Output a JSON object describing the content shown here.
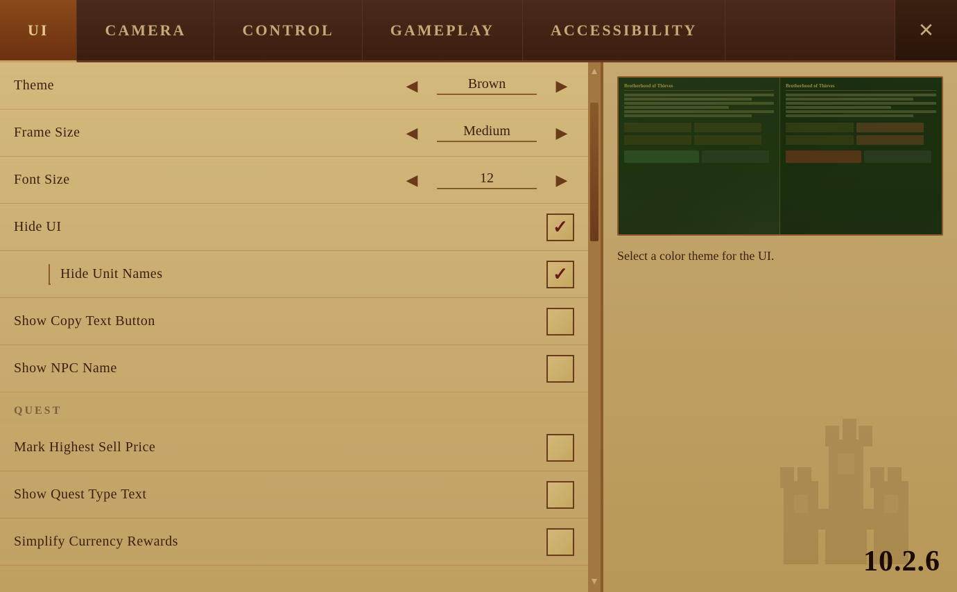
{
  "tabs": [
    {
      "id": "ui",
      "label": "UI",
      "active": true
    },
    {
      "id": "camera",
      "label": "CAMERA",
      "active": false
    },
    {
      "id": "control",
      "label": "CONTROL",
      "active": false
    },
    {
      "id": "gameplay",
      "label": "GAMEPLAY",
      "active": false
    },
    {
      "id": "accessibility",
      "label": "ACCESSIBILITY",
      "active": false
    }
  ],
  "close_button": "✕",
  "settings": {
    "theme": {
      "label": "Theme",
      "value": "Brown"
    },
    "frame_size": {
      "label": "Frame Size",
      "value": "Medium"
    },
    "font_size": {
      "label": "Font Size",
      "value": "12"
    },
    "hide_ui": {
      "label": "Hide UI",
      "checked": true
    },
    "hide_unit_names": {
      "label": "Hide Unit Names",
      "checked": true,
      "indented": true
    },
    "show_copy_text": {
      "label": "Show Copy Text Button",
      "checked": false
    },
    "show_npc_name": {
      "label": "Show NPC Name",
      "checked": false
    },
    "quest_section": "QUEST",
    "mark_highest_sell": {
      "label": "Mark Highest Sell Price",
      "checked": false
    },
    "show_quest_type": {
      "label": "Show Quest Type Text",
      "checked": false
    },
    "simplify_currency": {
      "label": "Simplify Currency Rewards",
      "checked": false
    }
  },
  "preview": {
    "description": "Select a color theme for the UI.",
    "panel_title_left": "Brotherhood of Thieves",
    "panel_title_right": "Brotherhood of Thieves"
  },
  "version": "10.2.6"
}
